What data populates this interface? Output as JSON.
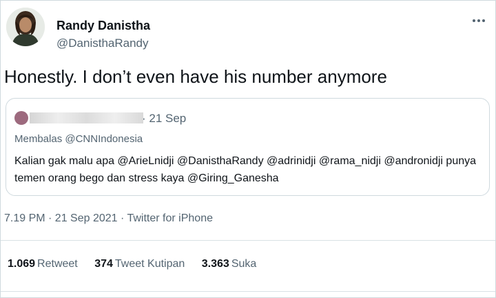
{
  "author": {
    "name": "Randy Danistha",
    "handle": "@DanisthaRandy"
  },
  "tweet": {
    "text": "Honestly. I don’t even have his number anymore",
    "timestamp": "7.19 PM · 21 Sep 2021 · Twitter for iPhone"
  },
  "quoted": {
    "date": "· 21 Sep",
    "reply_to": "Membalas @CNNIndonesia",
    "text": "Kalian gak malu apa @ArieLnidji @DanisthaRandy @adrinidji @rama_nidji @andronidji punya temen orang bego dan stress kaya @Giring_Ganesha"
  },
  "stats": {
    "retweets_count": "1.069",
    "retweets_label": "Retweet",
    "quotes_count": "374",
    "quotes_label": "Tweet Kutipan",
    "likes_count": "3.363",
    "likes_label": "Suka"
  },
  "icons": {
    "more": "more-horizontal-icon"
  }
}
